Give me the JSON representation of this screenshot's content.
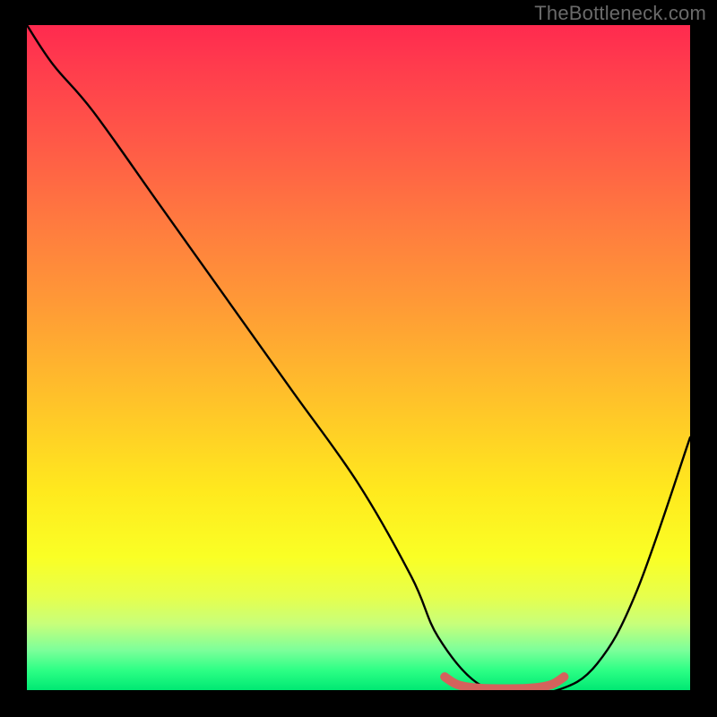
{
  "attribution": "TheBottleneck.com",
  "chart_data": {
    "type": "line",
    "title": "",
    "xlabel": "",
    "ylabel": "",
    "xlim": [
      0,
      100
    ],
    "ylim": [
      0,
      100
    ],
    "series": [
      {
        "name": "bottleneck-curve",
        "x": [
          0,
          4,
          10,
          20,
          30,
          40,
          50,
          58,
          62,
          68,
          74,
          80,
          86,
          92,
          100
        ],
        "y": [
          100,
          94,
          87,
          73,
          59,
          45,
          31,
          17,
          8,
          1,
          0,
          0,
          4,
          15,
          38
        ]
      },
      {
        "name": "optimal-range",
        "x": [
          63,
          65,
          68,
          72,
          76,
          79,
          81
        ],
        "y": [
          2,
          0.8,
          0.3,
          0.2,
          0.3,
          0.8,
          2
        ]
      }
    ],
    "gradient_stops": [
      {
        "pos": 0,
        "color": "#ff2a4f"
      },
      {
        "pos": 18,
        "color": "#ff5a47"
      },
      {
        "pos": 42,
        "color": "#ff9a36"
      },
      {
        "pos": 70,
        "color": "#ffe91e"
      },
      {
        "pos": 90,
        "color": "#c8ff7a"
      },
      {
        "pos": 100,
        "color": "#00e873"
      }
    ]
  }
}
